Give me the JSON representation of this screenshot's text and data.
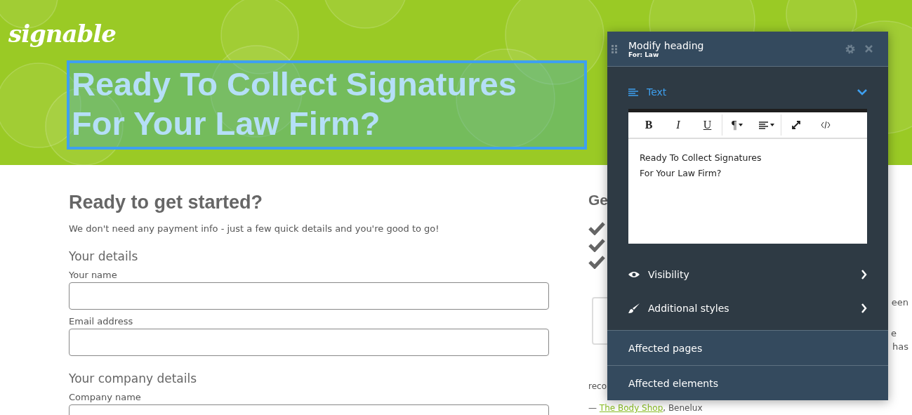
{
  "logo": "signable",
  "hero": {
    "heading_lines": [
      "Ready To Collect Signatures",
      "For Your Law Firm?"
    ],
    "selected": true
  },
  "form": {
    "title": "Ready to get started?",
    "intro": "We don't need any payment info - just a few quick details and you're good to go!",
    "sections": [
      {
        "title": "Your details",
        "fields": [
          {
            "label": "Your name"
          },
          {
            "label": "Email address"
          }
        ]
      },
      {
        "title": "Your company details",
        "fields": [
          {
            "label": "Company name"
          }
        ]
      }
    ]
  },
  "side": {
    "heading": "Ge",
    "fragments": [
      "een",
      "e",
      "has"
    ],
    "quote_start": "reco",
    "attribution": {
      "dash": "—",
      "link": "The Body Shop",
      "rest": ", Benelux"
    }
  },
  "panel": {
    "title": "Modify heading",
    "subtitle": "For: Law",
    "text_section": {
      "label": "Text",
      "expanded": true
    },
    "toolbar": [
      {
        "kind": "bold",
        "label": "B"
      },
      {
        "kind": "italic",
        "label": "I"
      },
      {
        "kind": "underline",
        "label": "U"
      },
      {
        "kind": "paragraph",
        "label": "¶"
      },
      {
        "kind": "align"
      },
      {
        "kind": "expand"
      },
      {
        "kind": "code"
      }
    ],
    "editor_lines": [
      "Ready To Collect Signatures",
      "For Your Law Firm?"
    ],
    "sections": [
      {
        "kind": "eye",
        "label": "Visibility",
        "expanded": false
      },
      {
        "kind": "brush",
        "label": "Additional styles",
        "expanded": false
      }
    ],
    "footer_rows": [
      "Affected pages",
      "Affected elements"
    ]
  }
}
